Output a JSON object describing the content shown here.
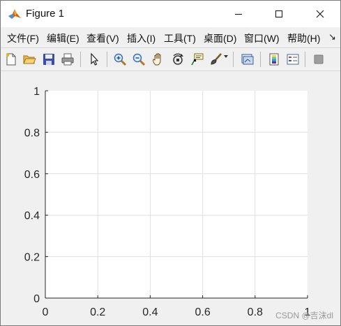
{
  "window": {
    "title": "Figure 1",
    "app_icon": "matlab-logo-icon",
    "controls": [
      "minimize-icon",
      "maximize-icon",
      "close-icon"
    ]
  },
  "menubar": {
    "items": [
      "文件(F)",
      "编辑(E)",
      "查看(V)",
      "插入(I)",
      "工具(T)",
      "桌面(D)",
      "窗口(W)",
      "帮助(H)"
    ],
    "overflow": "↘"
  },
  "toolbar": {
    "buttons": [
      {
        "name": "new-figure-icon"
      },
      {
        "name": "open-file-icon"
      },
      {
        "name": "save-icon"
      },
      {
        "name": "print-icon"
      },
      {
        "name": "select-pointer-icon"
      },
      {
        "name": "zoom-in-icon"
      },
      {
        "name": "zoom-out-icon"
      },
      {
        "name": "pan-hand-icon"
      },
      {
        "name": "rotate-3d-icon"
      },
      {
        "name": "data-cursor-icon"
      },
      {
        "name": "brush-icon"
      },
      {
        "name": "link-plot-icon"
      },
      {
        "name": "insert-colorbar-icon"
      },
      {
        "name": "insert-legend-icon"
      },
      {
        "name": "hide-plot-tools-icon"
      }
    ]
  },
  "chart_data": {
    "type": "line",
    "title": "",
    "xlabel": "",
    "ylabel": "",
    "xlim": [
      0,
      1
    ],
    "ylim": [
      0,
      1
    ],
    "xticks": [
      "0",
      "0.2",
      "0.4",
      "0.6",
      "0.8",
      "1"
    ],
    "yticks": [
      "0",
      "0.2",
      "0.4",
      "0.6",
      "0.8",
      "1"
    ],
    "grid": true,
    "series": []
  },
  "watermark": "CSDN @吉沫dl",
  "colors": {
    "figure_bg": "#f0f0f0",
    "axes_bg": "#ffffff",
    "grid": "#dfdfdf",
    "axis": "#262626",
    "close_hover": "#e81123"
  }
}
